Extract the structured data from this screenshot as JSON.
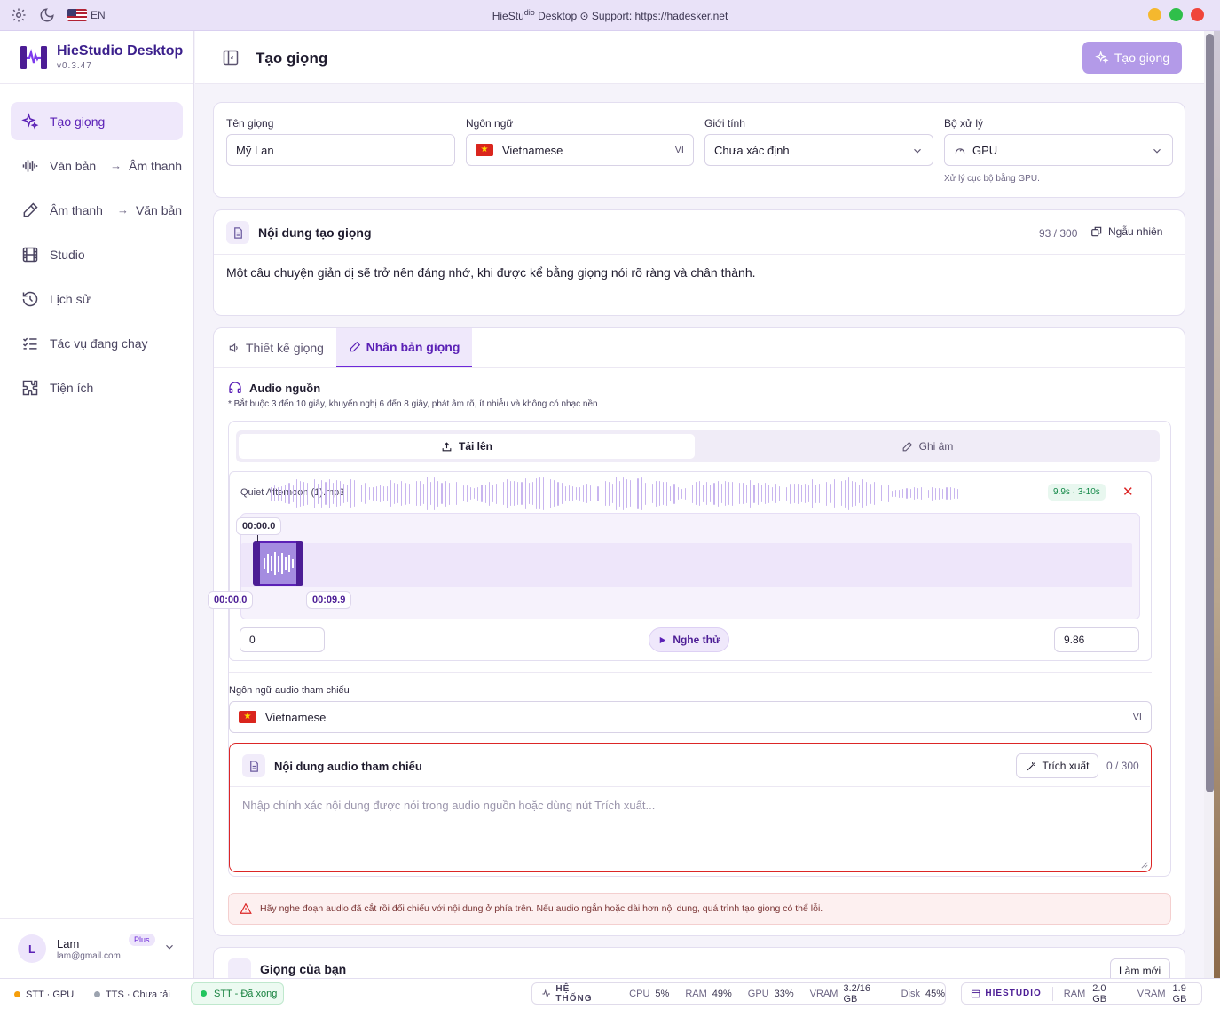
{
  "titlebar": {
    "title_prefix": "HieStu",
    "title_mid": "dio",
    "title_suffix": " Desktop ⊙ Support: https://hadesker.net",
    "lang": "EN"
  },
  "brand": {
    "name": "HieStudio Desktop",
    "version": "v0.3.47"
  },
  "nav": {
    "create_voice": "Tạo giọng",
    "tts_a": "Văn bản",
    "tts_b": "Âm thanh",
    "stt_a": "Âm thanh",
    "stt_b": "Văn bản",
    "studio": "Studio",
    "history": "Lịch sử",
    "running": "Tác vụ đang chạy",
    "utils": "Tiện ích"
  },
  "user": {
    "initial": "L",
    "name": "Lam",
    "email": "lam@gmail.com",
    "plan": "Plus"
  },
  "header": {
    "title": "Tạo giọng",
    "create_button": "Tạo giọng"
  },
  "settings": {
    "voice_name_label": "Tên giọng",
    "voice_name_value": "Mỹ Lan",
    "language_label": "Ngôn ngữ",
    "language_value": "Vietnamese",
    "language_code": "VI",
    "gender_label": "Giới tính",
    "gender_value": "Chưa xác định",
    "processor_label": "Bộ xử lý",
    "processor_value": "GPU",
    "processor_hint": "Xử lý cục bộ bằng GPU."
  },
  "content": {
    "title": "Nội dung tạo giọng",
    "count": "93 / 300",
    "random_button": "Ngẫu nhiên",
    "text": "Một câu chuyện giản dị sẽ trở nên đáng nhớ, khi được kể bằng giọng nói rõ ràng và chân thành."
  },
  "tabs": {
    "design": "Thiết kế giọng",
    "clone": "Nhân bản giọng"
  },
  "source": {
    "title": "Audio nguồn",
    "note": "* Bắt buộc 3 đến 10 giây, khuyến nghị 6 đến 8 giây, phát âm rõ, ít nhiễu và không có nhạc nền",
    "upload_tab": "Tải lên",
    "record_tab": "Ghi âm",
    "file_name": "Quiet Afternoon (1).mp3",
    "duration_badge": "9.9s · 3-10s",
    "marker_top": "00:00.0",
    "marker_start": "00:00.0",
    "marker_end": "00:09.9",
    "start_value": "0",
    "end_value": "9.86",
    "play_button": "Nghe thử"
  },
  "reference": {
    "language_label": "Ngôn ngữ audio tham chiếu",
    "language_value": "Vietnamese",
    "language_code": "VI",
    "title": "Nội dung audio tham chiếu",
    "extract_button": "Trích xuất",
    "count": "0 / 300",
    "placeholder": "Nhập chính xác nội dung được nói trong audio nguồn hoặc dùng nút Trích xuất..."
  },
  "warning": "Hãy nghe đoạn audio đã cắt rồi đối chiếu với nội dung ở phía trên. Nếu audio ngắn hoặc dài hơn nội dung, quá trình tạo giọng có thể lỗi.",
  "next_card": {
    "title": "Giọng của bạn",
    "button": "Làm mới"
  },
  "status": {
    "stt_gpu": "STT · GPU",
    "tts": "TTS · Chưa tải",
    "stt_done": "STT - Đã xong",
    "system_label": "HỆ THỐNG",
    "cpu_label": "CPU",
    "cpu_value": "5%",
    "ram_label": "RAM",
    "ram_value": "49%",
    "gpu_label": "GPU",
    "gpu_value": "33%",
    "vram_label": "VRAM",
    "vram_value": "3.2/16 GB",
    "disk_label": "Disk",
    "disk_value": "45%",
    "app_label": "HIESTUDIO",
    "app_ram_label": "RAM",
    "app_ram_value": "2.0 GB",
    "app_vram_label": "VRAM",
    "app_vram_value": "1.9 GB"
  },
  "colors": {
    "accent": "#6d28d9",
    "accent_soft": "#efe8fb",
    "primary_button": "#b39ae8",
    "error": "#dc2626"
  }
}
